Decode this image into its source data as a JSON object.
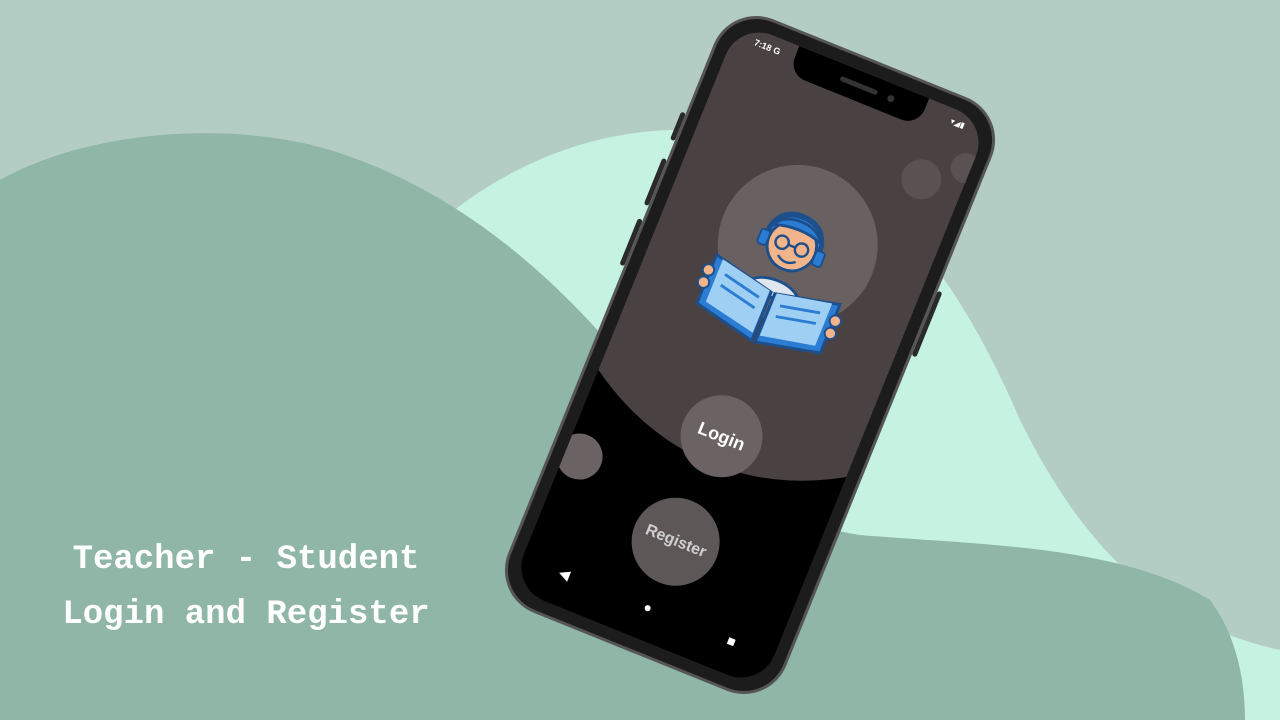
{
  "caption": {
    "line1": "Teacher - Student",
    "line2": "Login and Register"
  },
  "status_bar": {
    "time": "7:18",
    "indicator": "G",
    "right_icons": "▾◢▮"
  },
  "app": {
    "login_label": "Login",
    "register_label": "Register"
  },
  "nav": {
    "back_icon": "◀",
    "home_icon": "●",
    "recents_icon": "■"
  },
  "colors": {
    "background": "#b3cdc5",
    "hill_dark": "#8fb6a6",
    "hill_light": "#c6f2e2",
    "screen_top": "#4a4142",
    "button": "#6a6263",
    "book_blue": "#2b7cd3"
  }
}
